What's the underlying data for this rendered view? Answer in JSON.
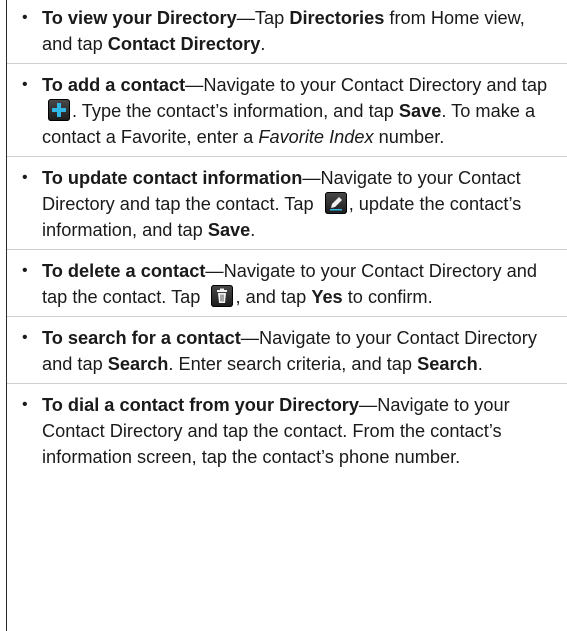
{
  "items": [
    {
      "title": "To view your Directory",
      "dash": "—",
      "text1": "Tap ",
      "b1": "Directories",
      "text2": " from Home view, and tap ",
      "b2": "Contact Directory",
      "text3": "."
    },
    {
      "title": "To add a contact",
      "dash": "—",
      "text1": "Navigate to your Contact Directory and tap ",
      "icon": "add-icon",
      "text2": ". Type the contact’s information, and tap ",
      "b1": "Save",
      "text3": ". To make a contact a Favorite, enter a ",
      "i1": "Favorite Index",
      "text4": " number."
    },
    {
      "title": "To update contact information",
      "dash": "—",
      "text1": "Navigate to your Contact Directory and tap the contact. Tap ",
      "icon": "edit-icon",
      "text2": ", update the contact’s information, and tap ",
      "b1": "Save",
      "text3": "."
    },
    {
      "title": "To delete a contact",
      "dash": "—",
      "text1": "Navigate to your Contact Directory and tap the contact. Tap ",
      "icon": "trash-icon",
      "text2": ", and tap ",
      "b1": "Yes",
      "text3": " to confirm."
    },
    {
      "title": "To search for a contact",
      "dash": "—",
      "text1": "Navigate to your Contact Directory and tap ",
      "b1": "Search",
      "text2": ". Enter search criteria, and tap ",
      "b2": "Search",
      "text3": "."
    },
    {
      "title": "To dial a contact from your Directory",
      "dash": "—",
      "text1": "Navigate to your Contact Directory and tap the contact. From the contact’s information screen, tap the contact’s phone number."
    }
  ],
  "bullet": "•",
  "colors": {
    "text": "#1a1a1a",
    "divider": "#cfcfcf",
    "icon_bg": "#2a2a2a",
    "add_icon": "#2fb6e6"
  }
}
